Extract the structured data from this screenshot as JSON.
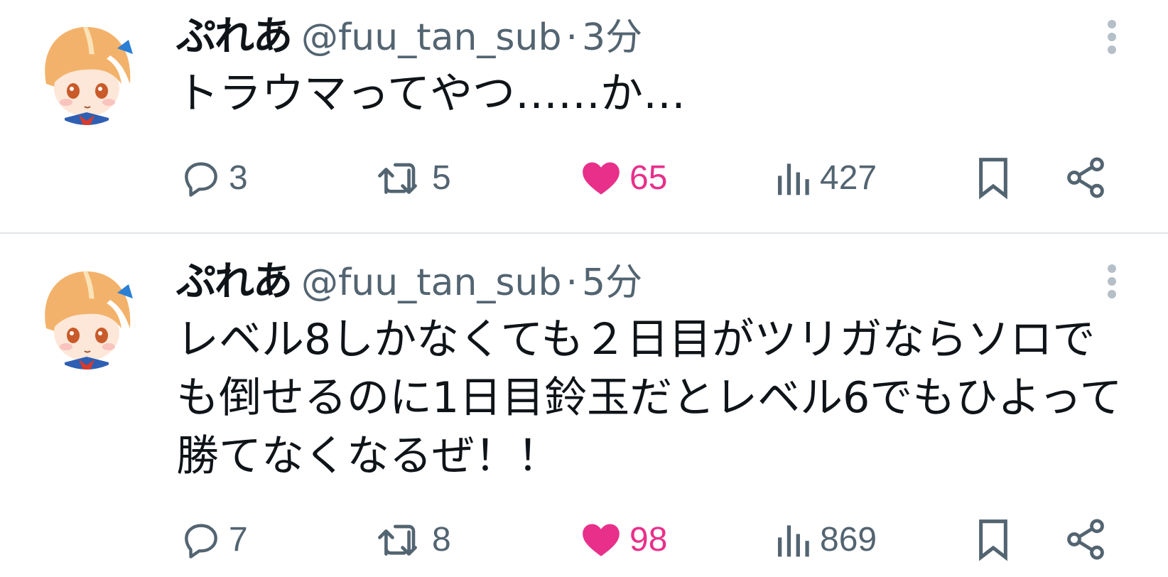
{
  "colors": {
    "text": "#0f1419",
    "muted": "#536471",
    "like": "#e8308a",
    "divider": "#e1e6ea"
  },
  "tweets": [
    {
      "display_name": "ぷれあ",
      "handle": "@fuu_tan_sub",
      "separator": "·",
      "time": "3分",
      "text": "トラウマってやつ……か…",
      "replies": "3",
      "retweets": "5",
      "likes": "65",
      "liked": true,
      "views": "427",
      "icons": [
        "avatar-icon",
        "more-icon",
        "reply-icon",
        "retweet-icon",
        "heart-icon",
        "views-icon",
        "bookmark-icon",
        "share-icon"
      ]
    },
    {
      "display_name": "ぷれあ",
      "handle": "@fuu_tan_sub",
      "separator": "·",
      "time": "5分",
      "text": "レベル8しかなくても２日目がツリガならソロでも倒せるのに1日目鈴玉だとレベル6でもひよって勝てなくなるぜ！！",
      "replies": "7",
      "retweets": "8",
      "likes": "98",
      "liked": true,
      "views": "869",
      "icons": [
        "avatar-icon",
        "more-icon",
        "reply-icon",
        "retweet-icon",
        "heart-icon",
        "views-icon",
        "bookmark-icon",
        "share-icon"
      ]
    }
  ]
}
